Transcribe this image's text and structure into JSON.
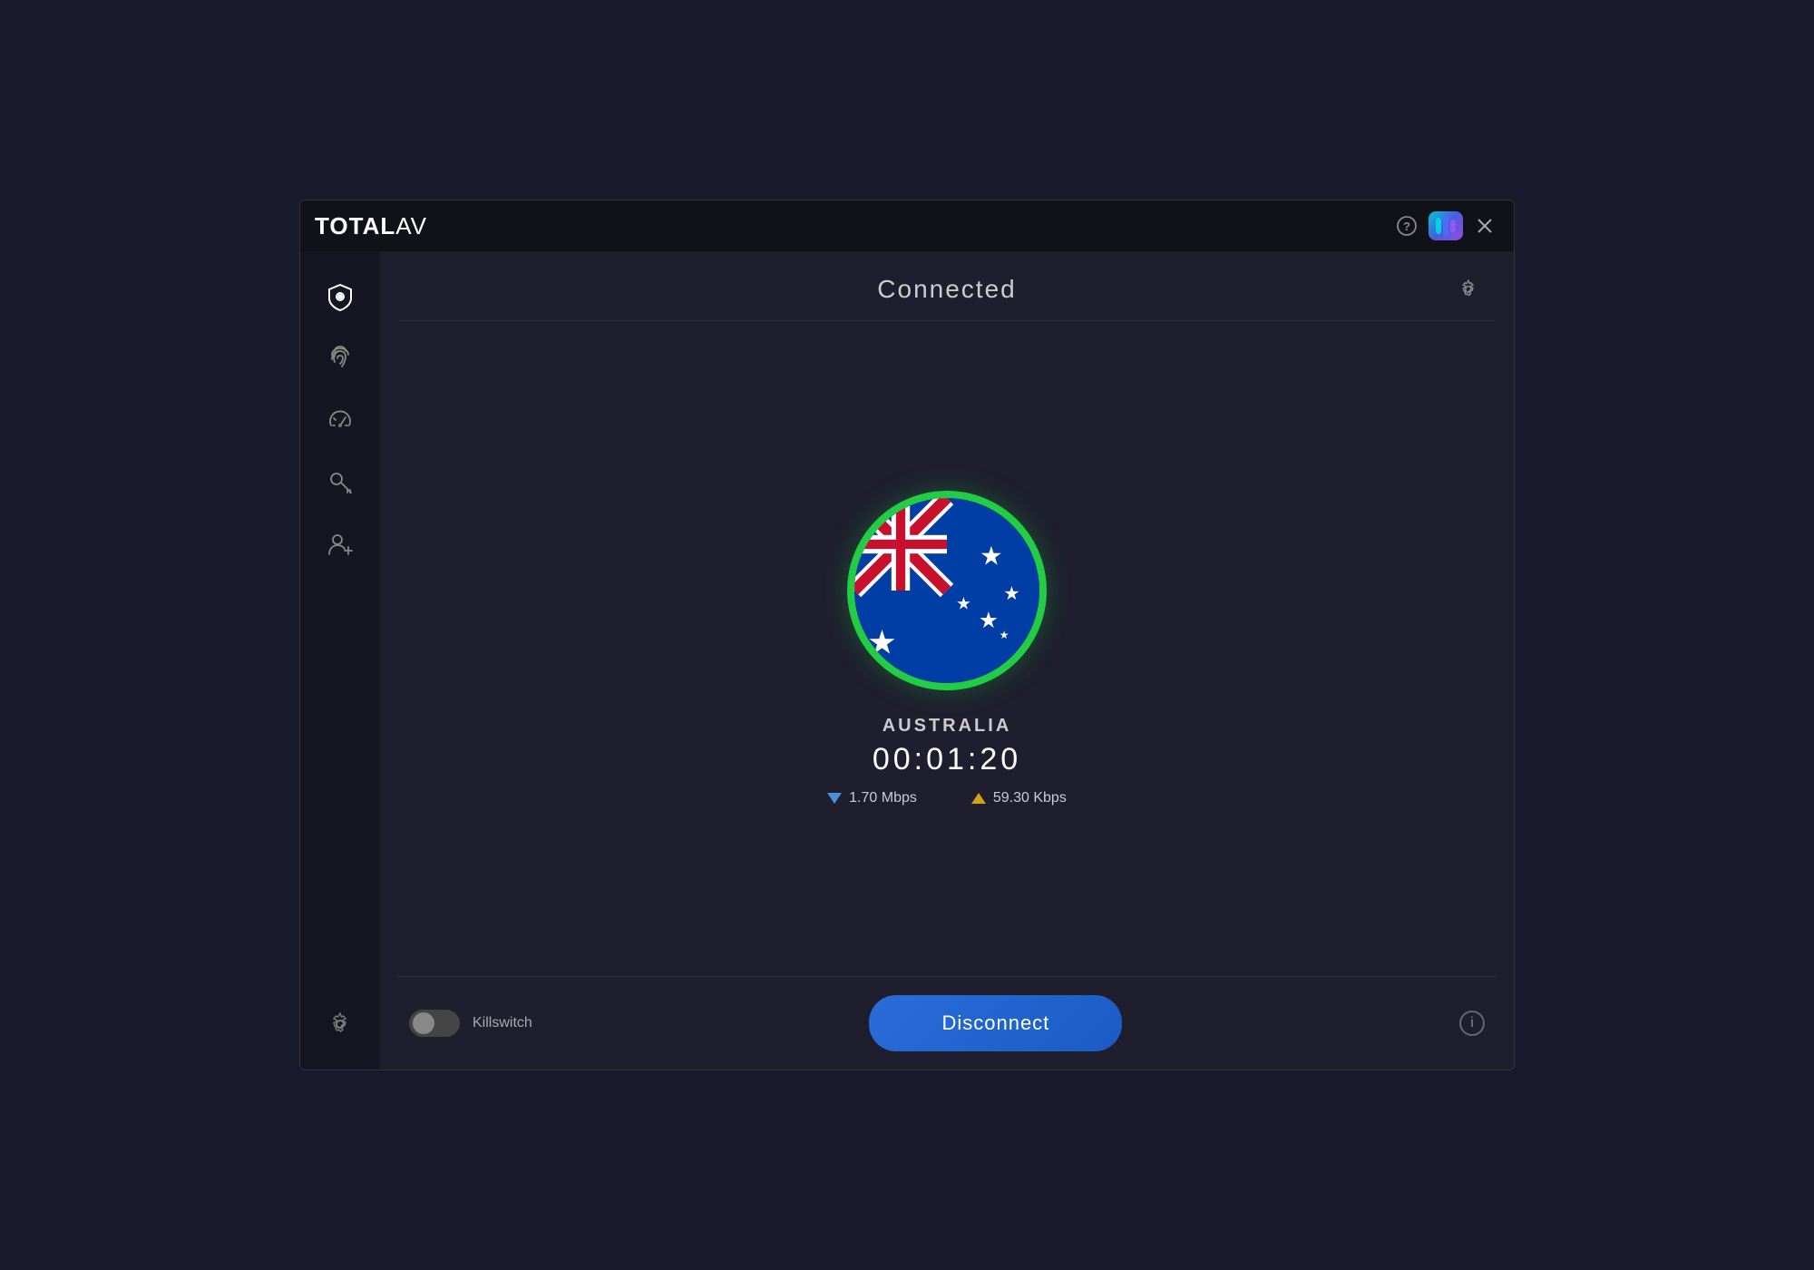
{
  "app": {
    "title_bold": "TOTAL",
    "title_light": "AV"
  },
  "header": {
    "connected_label": "Connected",
    "settings_label": "Settings"
  },
  "vpn": {
    "country": "AUSTRALIA",
    "timer": "00:01:20",
    "download_speed": "1.70 Mbps",
    "upload_speed": "59.30 Kbps"
  },
  "footer": {
    "killswitch_label": "Killswitch",
    "disconnect_label": "Disconnect",
    "info_label": "i"
  },
  "sidebar": {
    "items": [
      {
        "name": "shield",
        "label": "Shield"
      },
      {
        "name": "fingerprint",
        "label": "Fingerprint"
      },
      {
        "name": "speedometer",
        "label": "Speedometer"
      },
      {
        "name": "key",
        "label": "Key"
      },
      {
        "name": "add-user",
        "label": "Add User"
      },
      {
        "name": "settings",
        "label": "Settings"
      }
    ]
  },
  "titlebar": {
    "help_label": "?",
    "close_label": "✕"
  }
}
